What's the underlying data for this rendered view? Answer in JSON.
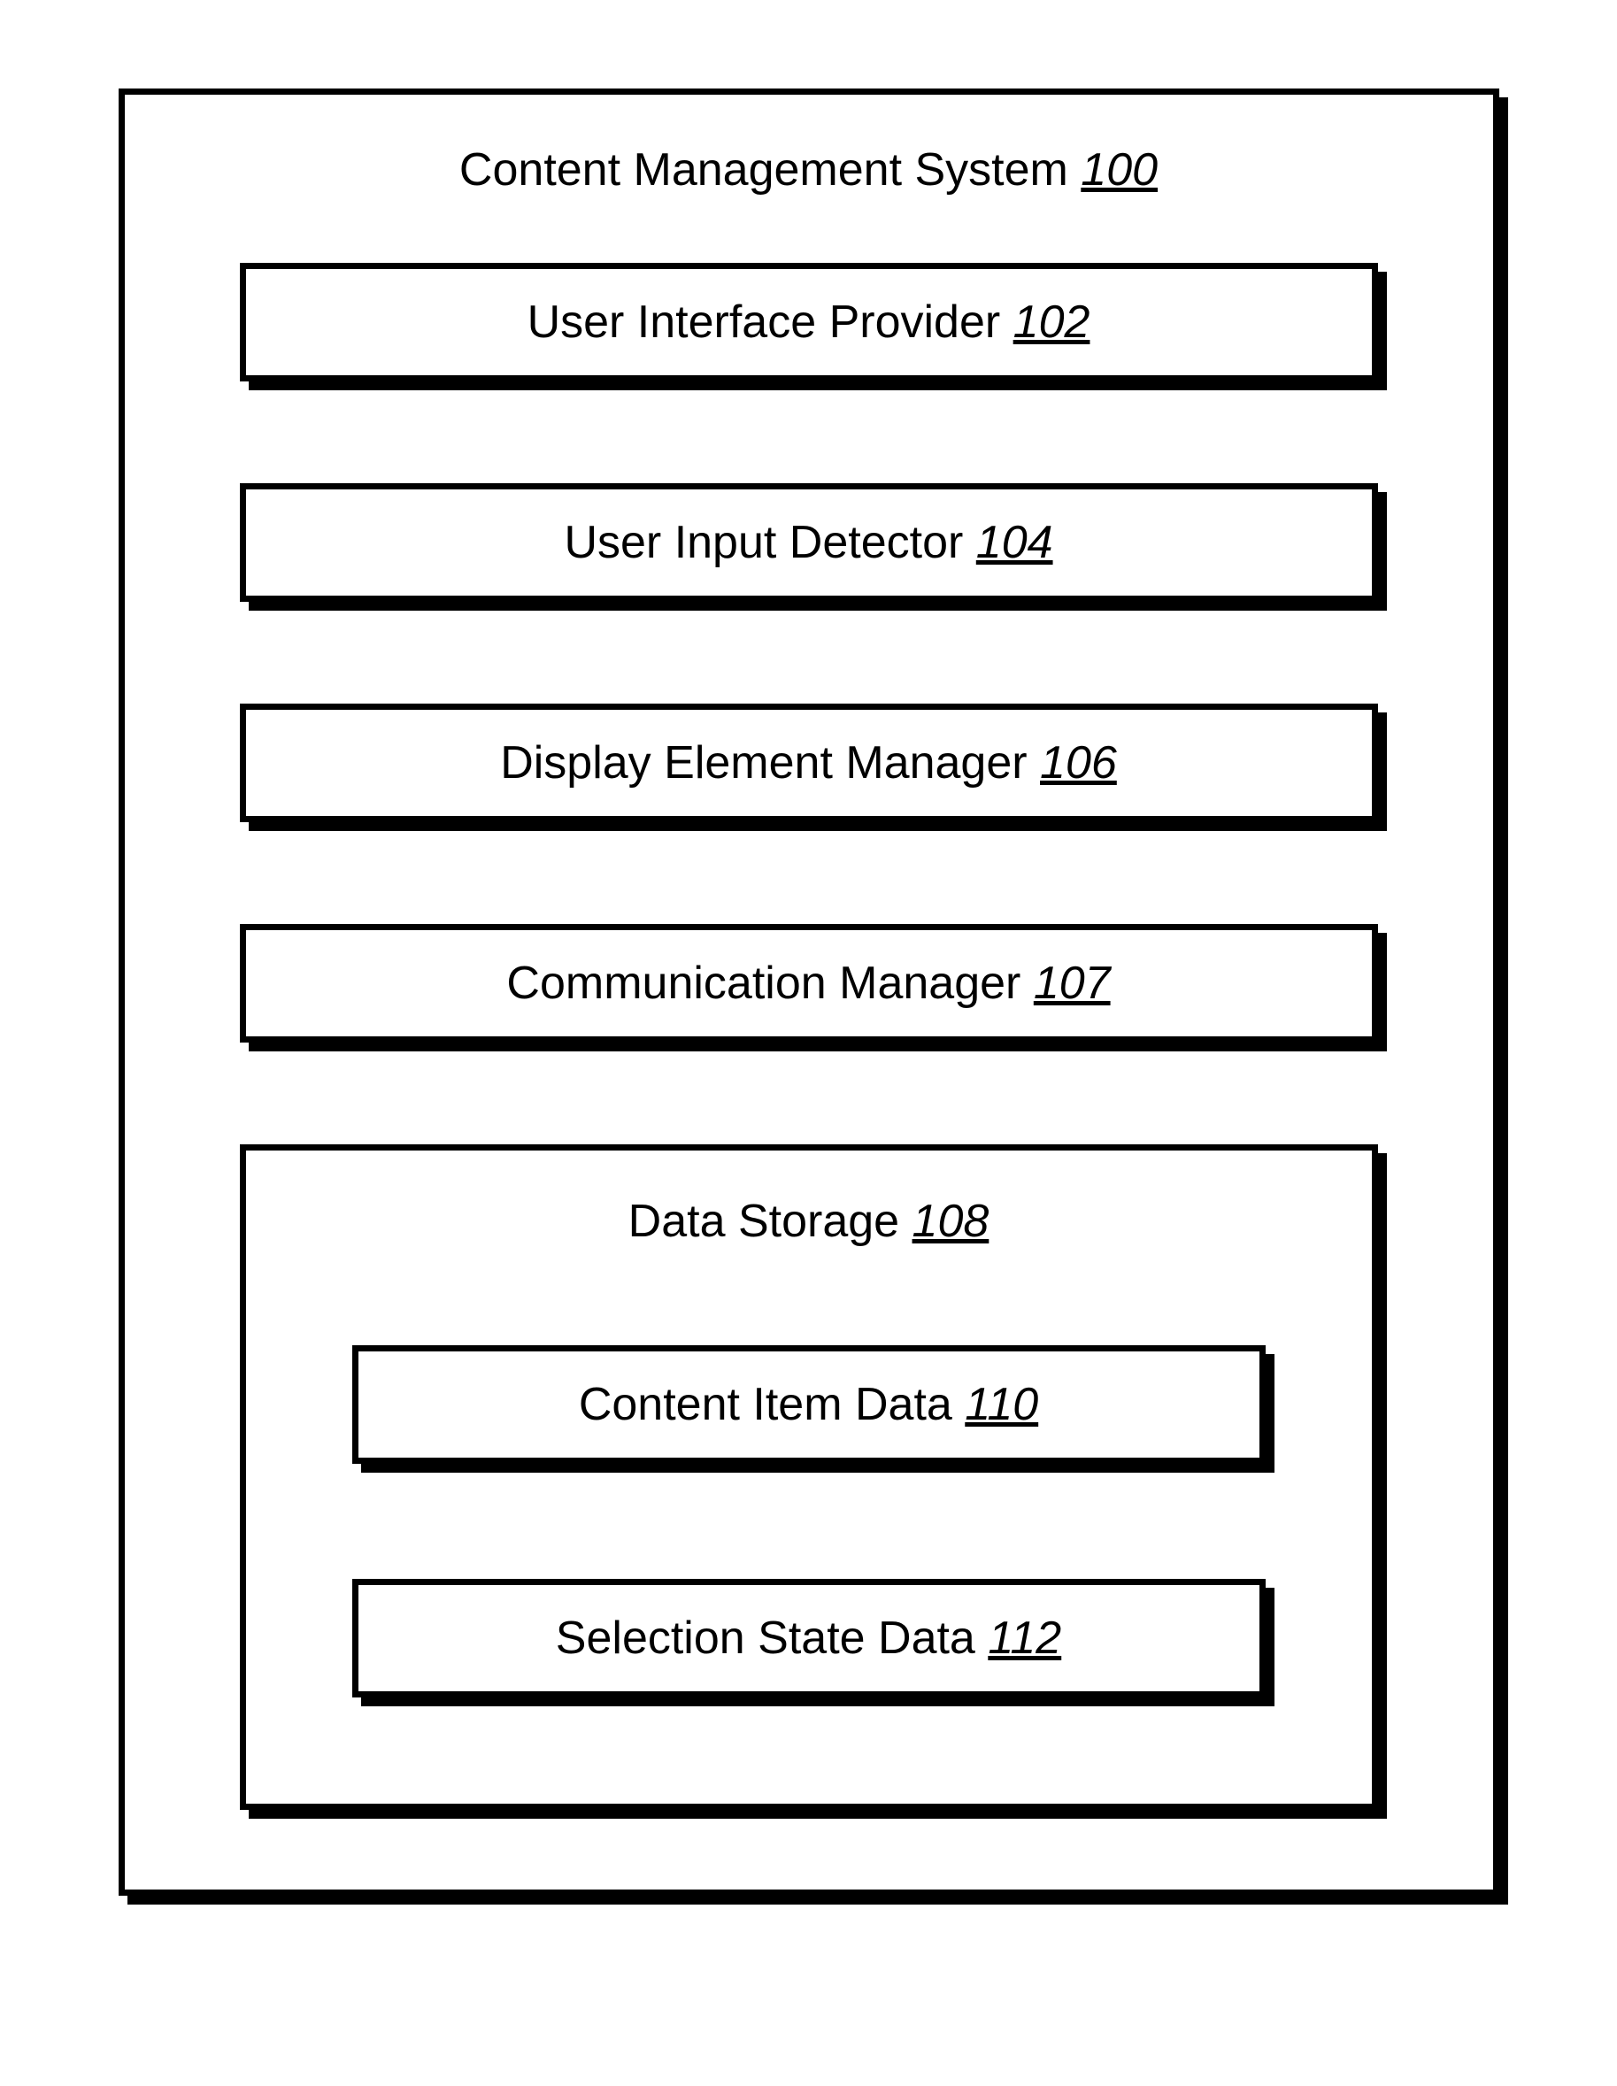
{
  "system": {
    "label": "Content Management System",
    "ref": "100"
  },
  "components": [
    {
      "label": "User Interface Provider",
      "ref": "102"
    },
    {
      "label": "User Input Detector",
      "ref": "104"
    },
    {
      "label": "Display Element Manager",
      "ref": "106"
    },
    {
      "label": "Communication Manager",
      "ref": "107"
    }
  ],
  "storage": {
    "label": "Data Storage",
    "ref": "108",
    "items": [
      {
        "label": "Content Item Data",
        "ref": "110"
      },
      {
        "label": "Selection State Data",
        "ref": "112"
      }
    ]
  }
}
